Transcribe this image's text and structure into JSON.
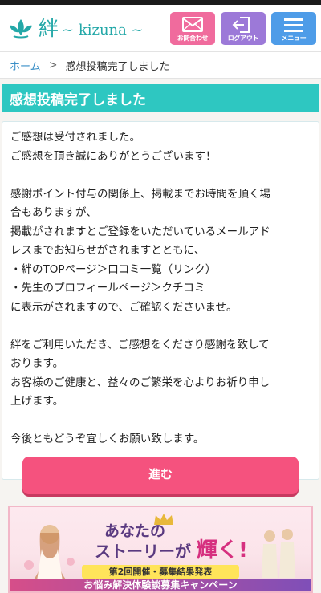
{
  "header": {
    "logo_kanji": "絆",
    "logo_roman": "~ kizuna ~",
    "buttons": [
      {
        "label": "お問合わせ",
        "icon": "mail-icon",
        "color": "#f06b9d"
      },
      {
        "label": "ログアウト",
        "icon": "logout-icon",
        "color": "#9c79d8"
      },
      {
        "label": "メニュー",
        "icon": "menu-icon",
        "color": "#4e9ce8"
      }
    ]
  },
  "breadcrumb": {
    "home": "ホーム",
    "separator": ">",
    "current": "感想投稿完了しました"
  },
  "page": {
    "title": "感想投稿完了しました",
    "lines": [
      "ご感想は受付されました。",
      "ご感想を頂き誠にありがとうございます！",
      "",
      "感謝ポイント付与の関係上、掲載までお時間を頂く場",
      "合もありますが、",
      "掲載がされますとご登録をいただいているメールアド",
      "レスまでお知らせがされますとともに、",
      "・絆のTOPページ＞口コミ一覧（リンク）",
      "・先生のプロフィールページ＞クチコミ",
      "に表示がされますので、ご確認くださいませ。",
      "",
      "絆をご利用いただき、ご感想をくださり感謝を致して",
      "おります。",
      "お客様のご健康と、益々のご繁栄を心よりお祈り申し",
      "上げます。",
      "",
      "今後ともどうぞ宜しくお願い致します。"
    ],
    "proceed_label": "進む"
  },
  "banner": {
    "line1": "あなたの",
    "line2": "ストーリーが",
    "shine": "輝く!",
    "result": "第2回開催・募集結果発表",
    "campaign": "お悩み解決体験談募集キャンペーン"
  },
  "colors": {
    "accent": "#2ec7c1",
    "proceed": "#f5527e",
    "link": "#3a8fc7"
  }
}
